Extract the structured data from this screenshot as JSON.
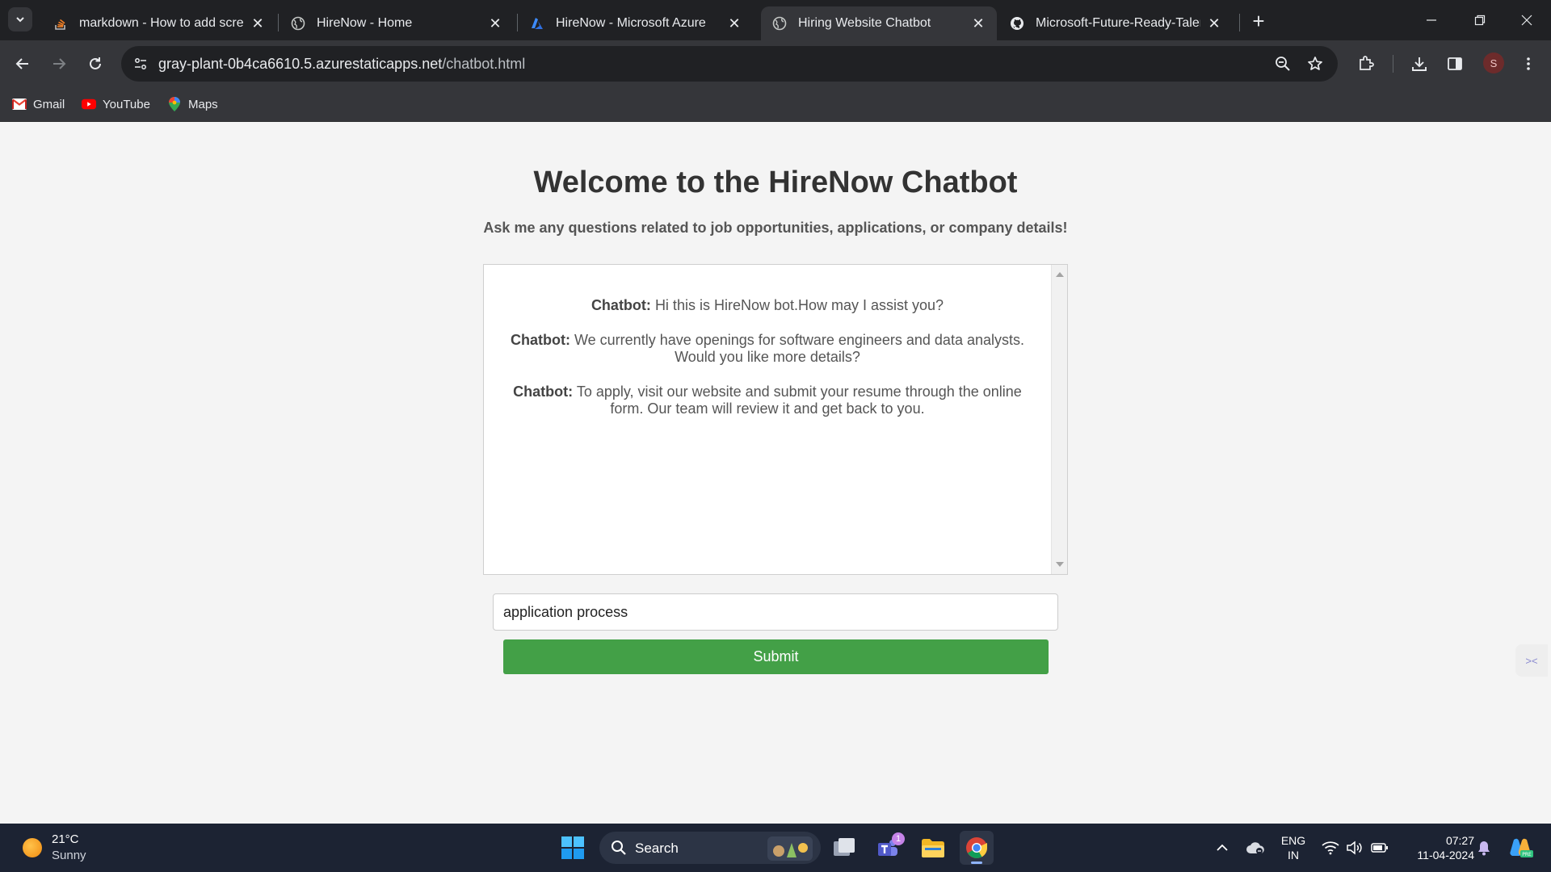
{
  "browser": {
    "tabs": [
      {
        "title": "markdown - How to add screen",
        "icon": "stackoverflow-icon"
      },
      {
        "title": "HireNow - Home",
        "icon": "globe-icon"
      },
      {
        "title": "HireNow - Microsoft Azure",
        "icon": "azure-icon"
      },
      {
        "title": "Hiring Website Chatbot",
        "icon": "globe-icon",
        "active": true
      },
      {
        "title": "Microsoft-Future-Ready-Talent-",
        "icon": "github-icon"
      }
    ],
    "url_host": "gray-plant-0b4ca6610.5.azurestaticapps.net",
    "url_path": "/chatbot.html",
    "profile_initial": "S",
    "bookmarks": [
      {
        "label": "Gmail",
        "icon": "gmail-icon"
      },
      {
        "label": "YouTube",
        "icon": "youtube-icon"
      },
      {
        "label": "Maps",
        "icon": "maps-icon"
      }
    ]
  },
  "page": {
    "heading": "Welcome to the HireNow Chatbot",
    "subheading": "Ask me any questions related to job opportunities, applications, or company details!",
    "messages": [
      {
        "sender": "Chatbot:",
        "text": "Hi this is HireNow bot.How may I assist you?"
      },
      {
        "sender": "Chatbot:",
        "text": "We currently have openings for software engineers and data analysts. Would you like more details?"
      },
      {
        "sender": "Chatbot:",
        "text": "To apply, visit our website and submit your resume through the online form. Our team will review it and get back to you."
      }
    ],
    "query_value": "application process",
    "submit_label": "Submit"
  },
  "taskbar": {
    "weather_temp": "21°C",
    "weather_desc": "Sunny",
    "search_label": "Search",
    "teams_badge": "1",
    "lang_line1": "ENG",
    "lang_line2": "IN",
    "time": "07:27",
    "date": "11-04-2024"
  },
  "colors": {
    "submit": "#43a047",
    "chrome_dark": "#202124",
    "chrome_toolbar": "#35363a",
    "taskbar": "#1c2333"
  }
}
